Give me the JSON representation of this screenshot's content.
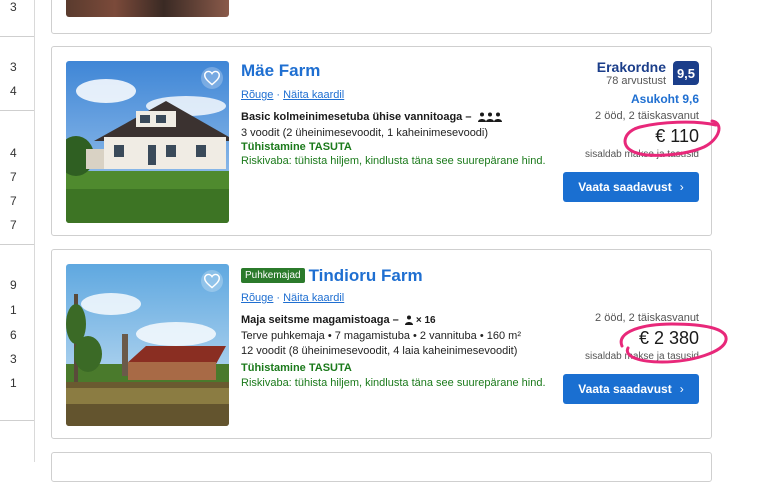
{
  "gutter": {
    "numbers": [
      "3",
      "3",
      "4",
      "4",
      "7",
      "7",
      "7",
      "9",
      "1",
      "6",
      "3",
      "1"
    ]
  },
  "listings": [
    {
      "title": "Mäe Farm",
      "links": {
        "area": "Rõuge",
        "map": "Näita kaardil"
      },
      "room": "Basic kolmeinimesetuba ühise vannitoaga",
      "beds": "3 voodit (2 üheinimesevoodit, 1 kaheinimesevoodi)",
      "cancel": "Tühistamine TASUTA",
      "risk": "Riskivaba: tühista hiljem, kindlusta täna see suurepärane hind.",
      "rating_word": "Erakordne",
      "reviews": "78 arvustust",
      "score": "9,5",
      "location": "Asukoht 9,6",
      "stay": "2 ööd, 2 täiskasvanut",
      "price": "€ 110",
      "incl": "sisaldab makse ja tasusid",
      "cta": "Vaata saadavust"
    },
    {
      "badge": "Puhkemajad",
      "title": "Tindioru Farm",
      "links": {
        "area": "Rõuge",
        "map": "Näita kaardil"
      },
      "room": "Maja seitsme magamistoaga",
      "guests": "× 16",
      "details": "Terve puhkemaja • 7 magamistuba • 2 vannituba • 160 m²",
      "beds": "12 voodit (8 üheinimesevoodit, 4 laia kaheinimesevoodit)",
      "cancel": "Tühistamine TASUTA",
      "risk": "Riskivaba: tühista hiljem, kindlusta täna see suurepärane hind.",
      "stay": "2 ööd, 2 täiskasvanut",
      "price": "€ 2 380",
      "incl": "sisaldab makse ja tasusid",
      "cta": "Vaata saadavust"
    }
  ],
  "colors": {
    "brand_blue": "#1f6fd1",
    "score_blue": "#1b3e8a",
    "green": "#1b7a1b",
    "scribble": "#e8287a"
  }
}
